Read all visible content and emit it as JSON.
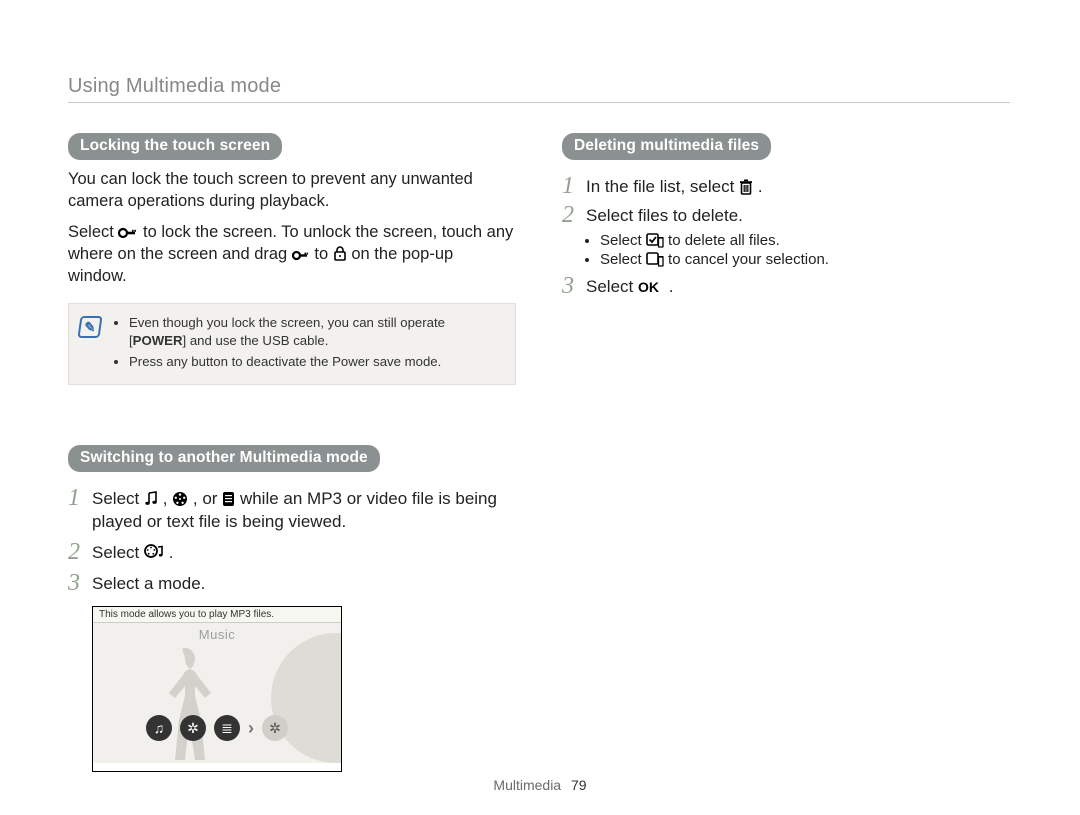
{
  "runningHead": "Using Multimedia mode",
  "colors": {
    "pill": "#8a9190",
    "stepnum": "#91a08f",
    "noteIcon": "#3b6fb0"
  },
  "footer": {
    "section": "Multimedia",
    "page": "79"
  },
  "left": {
    "lock": {
      "heading": "Locking the touch screen",
      "p1": "You can lock the touch screen to prevent any unwanted camera operations during playback.",
      "p2_a": "Select ",
      "p2_b": " to lock the screen. To unlock the screen, touch any where on the screen and drag ",
      "p2_c": " to ",
      "p2_d": " on the pop-up window.",
      "note": {
        "bullet1_a": "Even though you lock the screen, you can still operate [",
        "bullet1_b": "POWER",
        "bullet1_c": "] and use the USB cable.",
        "bullet2": "Press any button to deactivate the Power save mode."
      }
    },
    "switch": {
      "heading": "Switching to another Multimedia mode",
      "step1_a": "Select ",
      "step1_b": ", ",
      "step1_c": ", or ",
      "step1_d": " while an MP3 or video file is being played or text file is being viewed.",
      "step2_a": "Select ",
      "step2_b": ".",
      "step3": "Select a mode.",
      "scr": {
        "tip": "This mode allows you to play MP3 files.",
        "label": "Music"
      }
    }
  },
  "right": {
    "delete": {
      "heading": "Deleting multimedia files",
      "step1_a": "In the file list, select ",
      "step1_b": ".",
      "step2": "Select files to delete.",
      "sub1_a": "Select ",
      "sub1_b": " to delete all files.",
      "sub2_a": "Select ",
      "sub2_b": " to cancel your selection.",
      "step3_a": "Select ",
      "step3_b": ".",
      "okword": "OK"
    }
  }
}
